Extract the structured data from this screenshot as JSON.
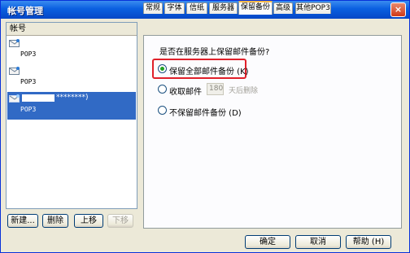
{
  "window": {
    "title": "帐号管理",
    "close_label": "×"
  },
  "accounts": {
    "header": "帐号",
    "items": [
      {
        "name": "",
        "type": "POP3"
      },
      {
        "name": "",
        "type": "POP3"
      },
      {
        "name": "********)",
        "type": "POP3",
        "selected": true
      }
    ],
    "buttons": {
      "new": "新建...",
      "delete": "删除",
      "up": "上移",
      "down": "下移"
    }
  },
  "tabs": [
    {
      "label": "常规"
    },
    {
      "label": "字体"
    },
    {
      "label": "信纸"
    },
    {
      "label": "服务器"
    },
    {
      "label": "保留备份",
      "active": true
    },
    {
      "label": "高级"
    },
    {
      "label": "其他POP3"
    }
  ],
  "backup": {
    "question": "是否在服务器上保留邮件备份?",
    "options": [
      {
        "label": "保留全部邮件备份 (K)",
        "checked": true
      },
      {
        "label": "收取邮件",
        "checked": false
      },
      {
        "label": "不保留邮件备份 (D)",
        "checked": false
      }
    ],
    "days_value": "180",
    "days_suffix": "天后删除"
  },
  "footer": {
    "ok": "确定",
    "cancel": "取消",
    "help": "帮助 (H)"
  },
  "colors": {
    "accent": "#316ac5",
    "highlight": "#e0202a",
    "title_bar": "#0a5fe0"
  }
}
